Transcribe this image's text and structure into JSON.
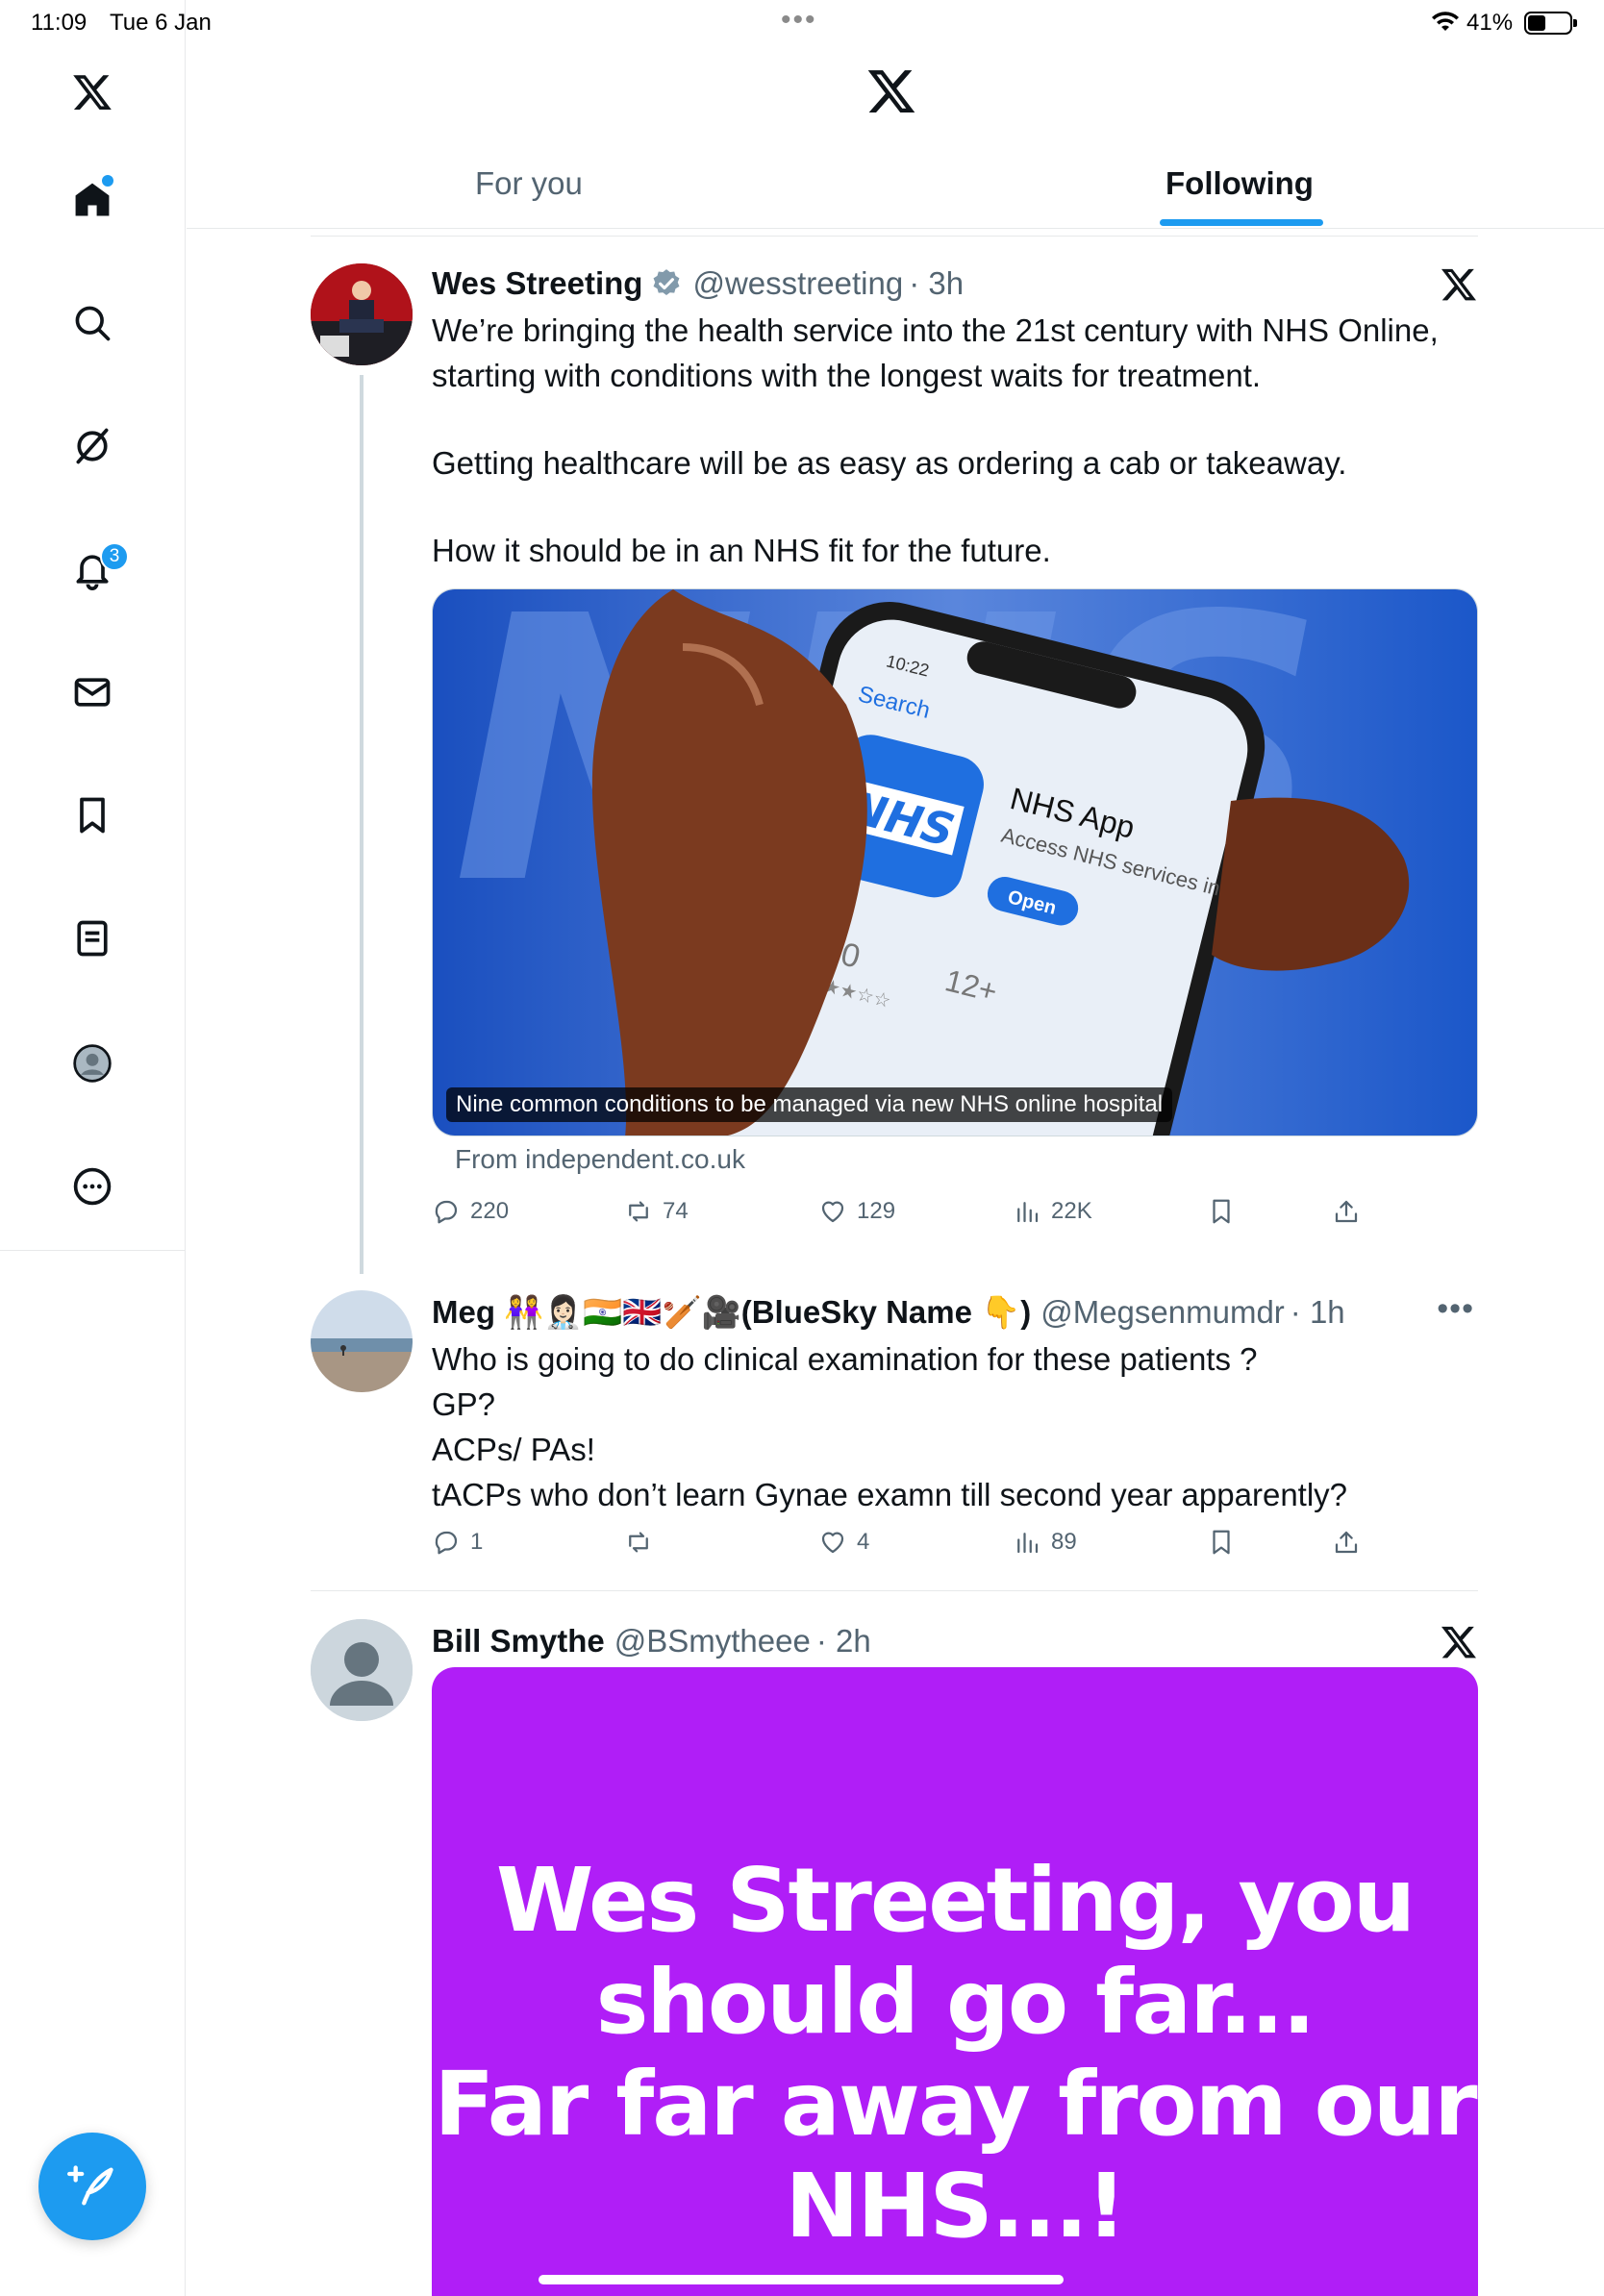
{
  "status": {
    "time": "11:09",
    "date": "Tue 6 Jan",
    "battery": "41%",
    "battery_level": 0.41
  },
  "sidebar": {
    "items": [
      "x-logo",
      "home",
      "search",
      "grok",
      "notifications",
      "messages",
      "bookmarks",
      "lists",
      "profile",
      "more"
    ],
    "notification_count": "3"
  },
  "header": {
    "tabs": [
      {
        "label": "For you",
        "selected": false
      },
      {
        "label": "Following",
        "selected": true
      }
    ]
  },
  "tweets": [
    {
      "name": "Wes Streeting",
      "verified": true,
      "handle": "@wesstreeting",
      "time": "· 3h",
      "text1": "We’re bringing the health service into the 21st century with NHS Online, starting with conditions with the longest waits for treatment.",
      "text2": "Getting healthcare will be as easy as ordering a cab or takeaway.",
      "text3": "How it should be in an NHS fit for the future.",
      "card": {
        "caption": "Nine common conditions to be managed via new NHS online hospital",
        "source": "From independent.co.uk",
        "app_name": "NHS App",
        "app_subtitle": "Access NHS services in England",
        "app_button": "Open",
        "search_label": "Search",
        "nhs_logo": "NHS",
        "rating": "3.0",
        "age": "12+",
        "phone_time": "10:22"
      },
      "replies": "220",
      "reposts": "74",
      "likes": "129",
      "views": "22K"
    },
    {
      "name": "Meg 👭👩🏻‍⚕️🇮🇳🇬🇧🏏🎥(BlueSky Name 👇)",
      "handle": "@Megsenmumdr",
      "time": "· 1h",
      "lines": [
        "Who is going to do clinical examination for these patients ?",
        "GP?",
        "ACPs/ PAs!",
        "tACPs who don’t learn Gynae examn till second year apparently?"
      ],
      "replies": "1",
      "reposts": "",
      "likes": "4",
      "views": "89"
    },
    {
      "name": "Bill Smythe",
      "handle": "@BSmytheee",
      "time": "· 2h",
      "image_text": [
        "Wes Streeting, you",
        "should go far...",
        "Far far away from our",
        "NHS...!"
      ],
      "image_color": "#b01ef7"
    }
  ]
}
